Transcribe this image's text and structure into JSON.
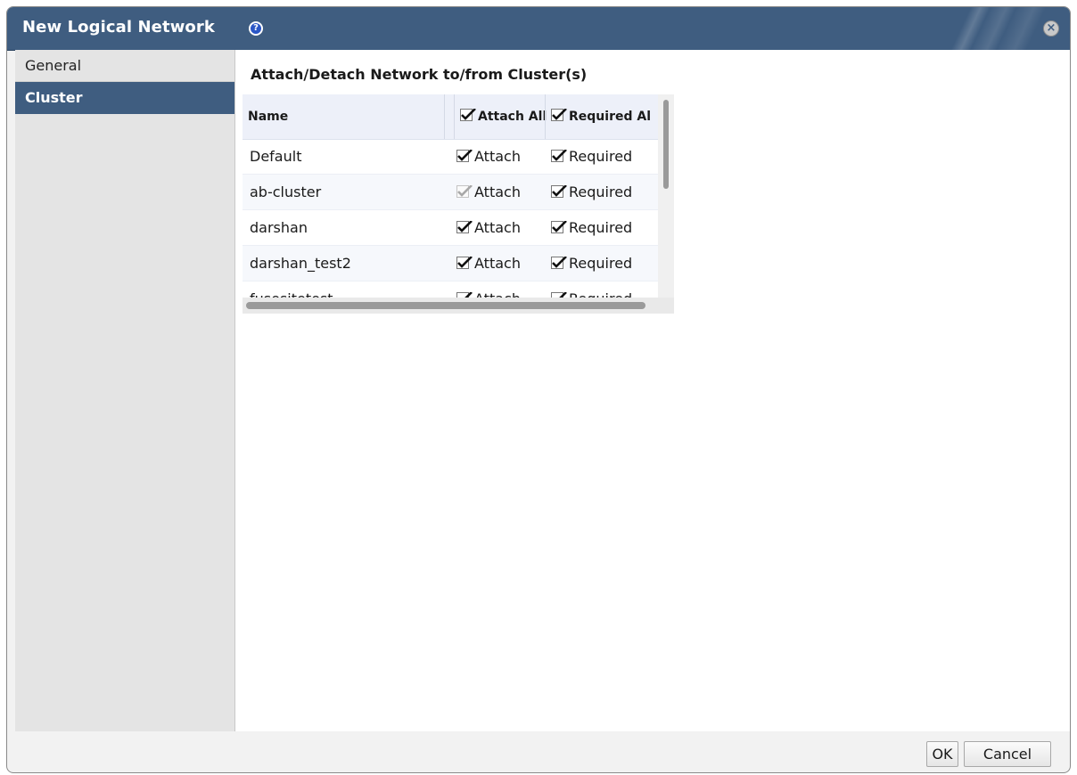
{
  "dialog": {
    "title": "New Logical Network",
    "help_icon": "help-icon",
    "close_icon": "close-icon"
  },
  "sidebar": {
    "items": [
      {
        "label": "General",
        "active": false
      },
      {
        "label": "Cluster",
        "active": true
      }
    ]
  },
  "main": {
    "section_title": "Attach/Detach Network to/from Cluster(s)",
    "grid": {
      "columns": {
        "name": "Name",
        "attach_all": "Attach All",
        "required_all": "Required Al"
      },
      "rows": [
        {
          "name": "Default",
          "attach": "Attach",
          "required": "Required",
          "attach_checked": true,
          "attach_disabled": false,
          "required_checked": true
        },
        {
          "name": "ab-cluster",
          "attach": "Attach",
          "required": "Required",
          "attach_checked": true,
          "attach_disabled": true,
          "required_checked": true
        },
        {
          "name": "darshan",
          "attach": "Attach",
          "required": "Required",
          "attach_checked": true,
          "attach_disabled": false,
          "required_checked": true
        },
        {
          "name": "darshan_test2",
          "attach": "Attach",
          "required": "Required",
          "attach_checked": true,
          "attach_disabled": false,
          "required_checked": true
        },
        {
          "name": "fusesitetest",
          "attach": "Attach",
          "required": "Required",
          "attach_checked": true,
          "attach_disabled": false,
          "required_checked": true
        }
      ]
    }
  },
  "footer": {
    "ok_label": "OK",
    "cancel_label": "Cancel"
  },
  "colors": {
    "titlebar": "#3f5d80",
    "active_tab": "#3f5d80",
    "grid_header": "#edf0f9"
  }
}
